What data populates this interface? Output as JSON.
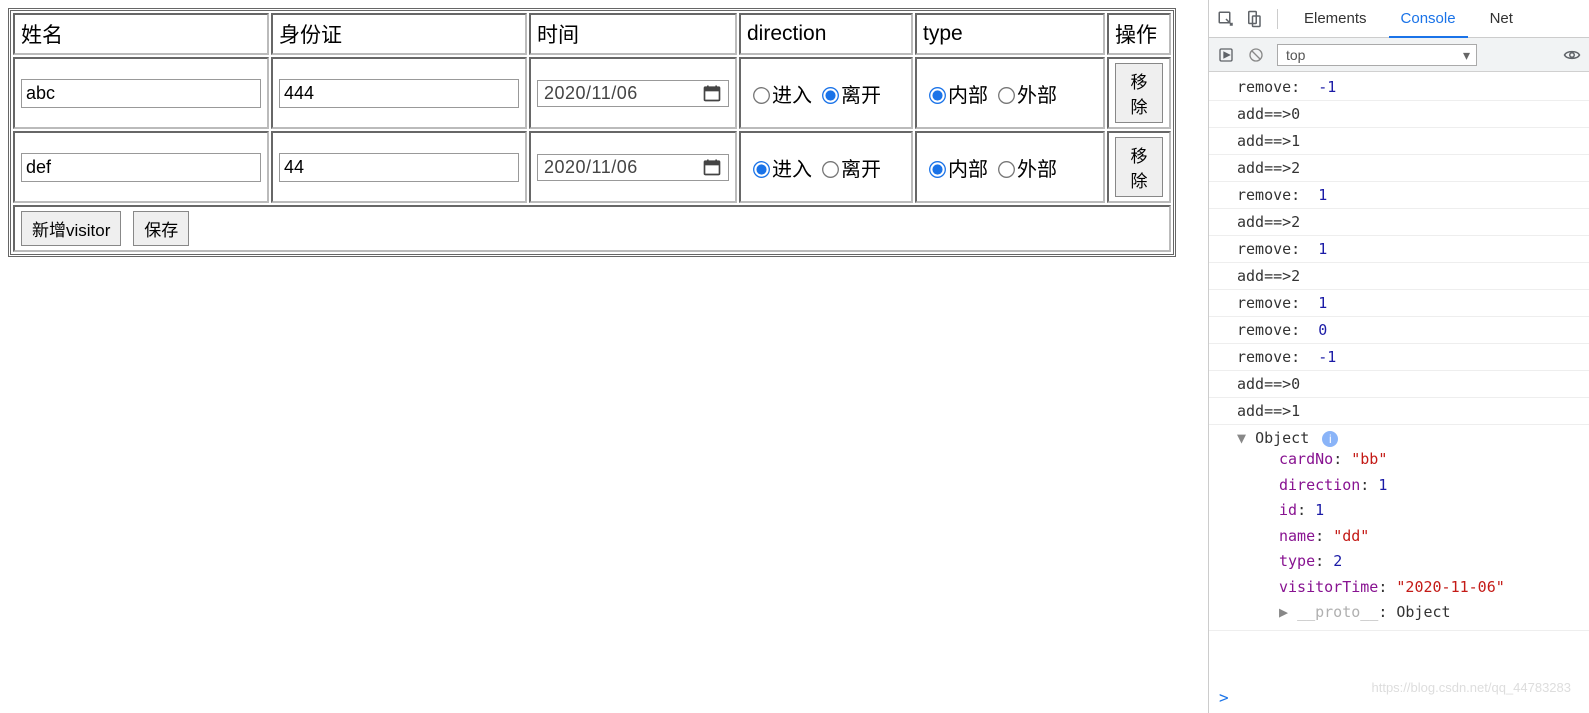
{
  "table": {
    "headers": {
      "name": "姓名",
      "idcard": "身份证",
      "time": "时间",
      "direction": "direction",
      "type": "type",
      "op": "操作"
    },
    "rows": [
      {
        "name": "abc",
        "idcard": "444",
        "date": "2020/11/06",
        "direction_enter": "进入",
        "direction_leave": "离开",
        "direction_checked": "leave",
        "type_inner": "内部",
        "type_outer": "外部",
        "type_checked": "inner",
        "remove": "移除"
      },
      {
        "name": "def",
        "idcard": "44",
        "date": "2020/11/06",
        "direction_enter": "进入",
        "direction_leave": "离开",
        "direction_checked": "enter",
        "type_inner": "内部",
        "type_outer": "外部",
        "type_checked": "inner",
        "remove": "移除"
      }
    ],
    "footer": {
      "add": "新增visitor",
      "save": "保存"
    }
  },
  "devtools": {
    "tabs": {
      "elements": "Elements",
      "console": "Console",
      "network": "Net"
    },
    "subbar": {
      "top": "top"
    },
    "logs": [
      {
        "prefix": "remove:  ",
        "value": "-1"
      },
      {
        "prefix": "add==>",
        "value": "0",
        "plain": true
      },
      {
        "prefix": "add==>",
        "value": "1",
        "plain": true
      },
      {
        "prefix": "add==>",
        "value": "2",
        "plain": true
      },
      {
        "prefix": "remove:  ",
        "value": "1"
      },
      {
        "prefix": "add==>",
        "value": "2",
        "plain": true
      },
      {
        "prefix": "remove:  ",
        "value": "1"
      },
      {
        "prefix": "add==>",
        "value": "2",
        "plain": true
      },
      {
        "prefix": "remove:  ",
        "value": "1"
      },
      {
        "prefix": "remove:  ",
        "value": "0"
      },
      {
        "prefix": "remove:  ",
        "value": "-1"
      },
      {
        "prefix": "add==>",
        "value": "0",
        "plain": true
      },
      {
        "prefix": "add==>",
        "value": "1",
        "plain": true
      }
    ],
    "object": {
      "label": "Object",
      "cardNo": "\"bb\"",
      "direction": "1",
      "id": "1",
      "name": "\"dd\"",
      "type": "2",
      "visitorTime": "\"2020-11-06\"",
      "proto": "Object"
    },
    "prompt": ">",
    "watermark": "https://blog.csdn.net/qq_44783283"
  }
}
